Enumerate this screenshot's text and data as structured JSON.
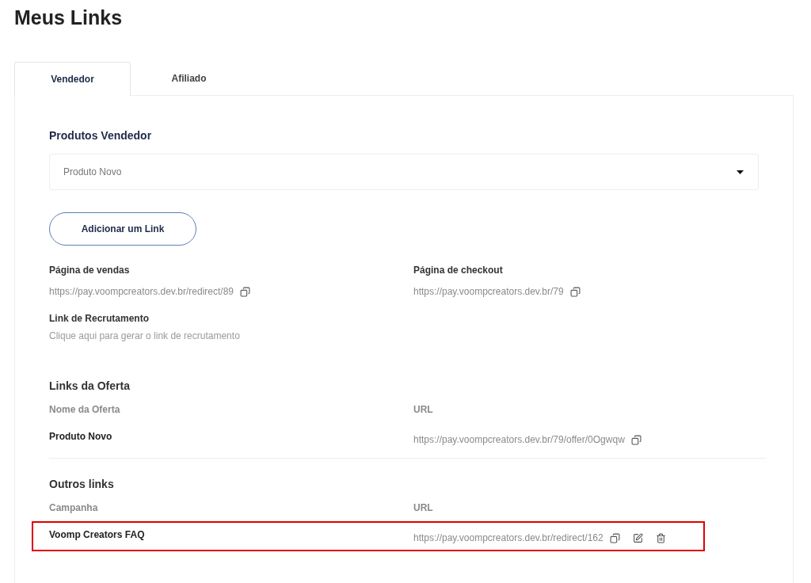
{
  "page_title": "Meus Links",
  "tabs": [
    {
      "label": "Vendedor",
      "selected": true
    },
    {
      "label": "Afiliado",
      "selected": false
    }
  ],
  "products": {
    "label": "Produtos Vendedor",
    "value": "Produto Novo"
  },
  "add_button": "Adicionar um Link",
  "sales_page": {
    "label": "Página de vendas",
    "url": "https://pay.voompcreators.dev.br/redirect/89"
  },
  "checkout_page": {
    "label": "Página de checkout",
    "url": "https://pay.voompcreators.dev.br/79"
  },
  "recruitment": {
    "label": "Link de Recrutamento",
    "link": "Clique aqui para gerar o link de recrutamento"
  },
  "offer_links": {
    "title": "Links da Oferta",
    "columns": [
      "Nome da Oferta",
      "URL"
    ],
    "rows": [
      {
        "name": "Produto Novo",
        "url": "https://pay.voompcreators.dev.br/79/offer/0Ogwqw",
        "editable": false,
        "highlighted": false
      }
    ]
  },
  "other_links": {
    "title": "Outros links",
    "columns": [
      "Campanha",
      "URL"
    ],
    "rows": [
      {
        "name": "Voomp Creators FAQ",
        "url": "https://pay.voompcreators.dev.br/redirect/162",
        "editable": true,
        "highlighted": true
      }
    ]
  }
}
